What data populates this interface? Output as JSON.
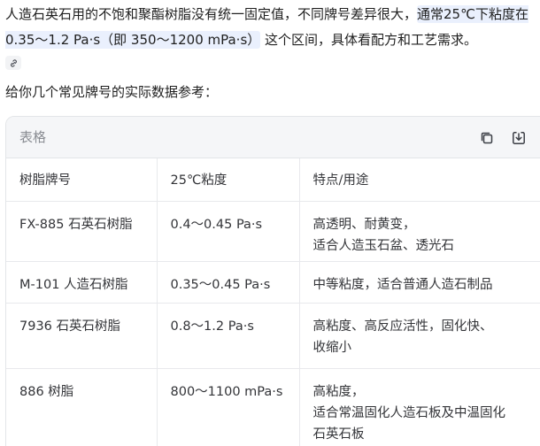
{
  "answer": {
    "part1": "人造石英石用的不饱和聚酯树脂没有统一固定值，不同牌号差异很大，",
    "highlight": "通常25℃下粘度在 0.35～1.2 Pa·s（即 350～1200 mPa·s）",
    "part2": " 这个区间，具体看配方和工艺需求。"
  },
  "intro": "给你几个常见牌号的实际数据参考：",
  "table": {
    "title": "表格",
    "headers": [
      "树脂牌号",
      "25℃粘度",
      "特点/用途"
    ],
    "rows": [
      {
        "grade": "FX-885 石英石树脂",
        "viscosity": "0.4～0.45 Pa·s",
        "features": [
          "高透明、耐黄变，",
          "适合人造玉石盆、透光石"
        ]
      },
      {
        "grade": "M-101 人造石树脂",
        "viscosity": "0.35～0.45 Pa·s",
        "features": [
          "中等粘度，适合普通人造石制品"
        ]
      },
      {
        "grade": "7936 石英石树脂",
        "viscosity": "0.8～1.2 Pa·s",
        "features": [
          "高粘度、高反应活性，固化快、",
          "收缩小"
        ]
      },
      {
        "grade": "886 树脂",
        "viscosity": "800～1100 mPa·s",
        "features": [
          "高粘度，",
          "适合常温固化人造石板及中温固化",
          "石英石板"
        ]
      }
    ]
  },
  "icons": {
    "link": "link-icon",
    "copy": "copy-icon",
    "download": "download-icon"
  },
  "colors": {
    "highlight_bg": "#eaf0fd",
    "table_header_bg": "#f5f6f8",
    "border": "#e3e5e8"
  }
}
